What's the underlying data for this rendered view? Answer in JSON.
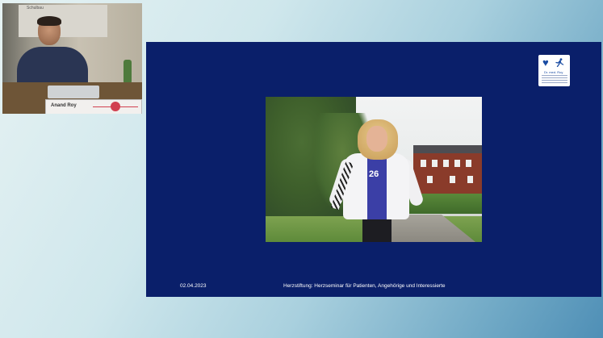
{
  "camera": {
    "speaker_name": "Anand Roy",
    "board_text": "Schulbau"
  },
  "slide": {
    "logo": {
      "name": "Dr. med. Roy",
      "icons": [
        "heart-icon",
        "runner-icon"
      ]
    },
    "photo": {
      "bib_number": "26"
    },
    "footer": {
      "date": "02.04.2023",
      "title": "Herzstiftung: Herzseminar für Patienten, Angehörige und Interessierte"
    }
  },
  "colors": {
    "slide_background": "#0a1f6a",
    "logo_blue": "#1a4ca3",
    "footer_text": "#ffffff"
  }
}
